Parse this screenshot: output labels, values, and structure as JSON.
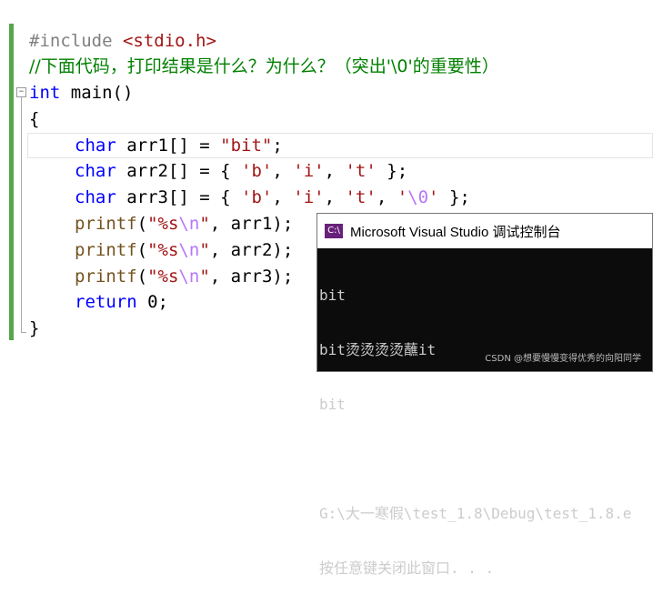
{
  "editor": {
    "line1": {
      "pp": "#include ",
      "inc": "<stdio.h>"
    },
    "line2": "//下面代码，打印结果是什么？为什么？（突出'\\0'的重要性）",
    "line3": {
      "kw": "int",
      "rest": " main()"
    },
    "line4": "{",
    "line5": {
      "kw": "char",
      "mid": " arr1[] = ",
      "str": "\"bit\"",
      "end": ";"
    },
    "line6": {
      "kw": "char",
      "mid": " arr2[] = { ",
      "c1": "'b'",
      "s1": ", ",
      "c2": "'i'",
      "s2": ", ",
      "c3": "'t'",
      "end": " };"
    },
    "line7": {
      "kw": "char",
      "mid": " arr3[] = { ",
      "c1": "'b'",
      "s1": ", ",
      "c2": "'i'",
      "s2": ", ",
      "c3": "'t'",
      "s3": ", ",
      "c4a": "'",
      "c4esc": "\\0",
      "c4b": "'",
      "end": " };"
    },
    "printf1": {
      "fn": "printf",
      "open": "(",
      "q1": "\"%s",
      "esc": "\\n",
      "q2": "\"",
      "args": ", arr1);"
    },
    "printf2": {
      "fn": "printf",
      "open": "(",
      "q1": "\"%s",
      "esc": "\\n",
      "q2": "\"",
      "args": ", arr2);"
    },
    "printf3": {
      "fn": "printf",
      "open": "(",
      "q1": "\"%s",
      "esc": "\\n",
      "q2": "\"",
      "args": ", arr3);"
    },
    "ret": {
      "kw": "return",
      "rest": " 0;"
    },
    "close": "}"
  },
  "console": {
    "icon": "C:\\",
    "title": "Microsoft Visual Studio 调试控制台",
    "lines": [
      "bit",
      "bit烫烫烫烫蘸it",
      "bit",
      "",
      "G:\\大一寒假\\test_1.8\\Debug\\test_1.8.e",
      "按任意键关闭此窗口. . ."
    ]
  },
  "watermark": "CSDN @想要慢慢变得优秀的向阳同学"
}
